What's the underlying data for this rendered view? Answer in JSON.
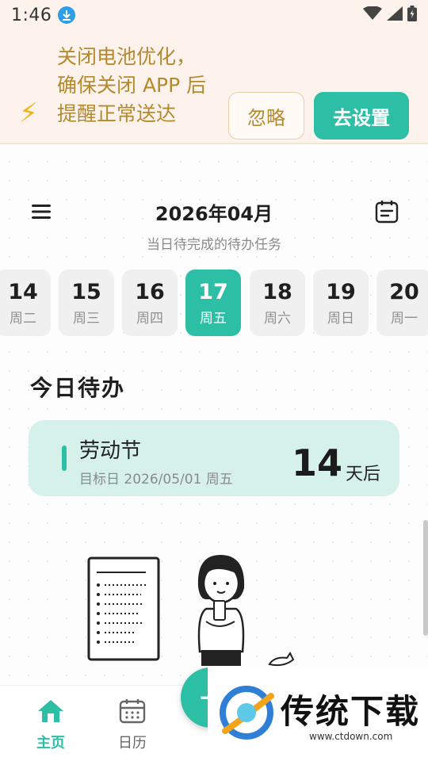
{
  "status_bar": {
    "time": "1:46"
  },
  "banner": {
    "lines": [
      "关闭电池优化，",
      "确保关闭 APP 后",
      "提醒正常送达"
    ],
    "ignore_label": "忽略",
    "settings_label": "去设置"
  },
  "header": {
    "month": "2026年04月",
    "subtitle": "当日待完成的待办任务"
  },
  "days": [
    {
      "num": "14",
      "week": "周二"
    },
    {
      "num": "15",
      "week": "周三"
    },
    {
      "num": "16",
      "week": "周四"
    },
    {
      "num": "17",
      "week": "周五",
      "selected": true
    },
    {
      "num": "18",
      "week": "周六"
    },
    {
      "num": "19",
      "week": "周日"
    },
    {
      "num": "20",
      "week": "周一"
    }
  ],
  "section_title": "今日待办",
  "todo": {
    "name": "劳动节",
    "date": "目标日 2026/05/01 周五",
    "count": "14",
    "unit": "天后"
  },
  "nav": {
    "home_label": "主页",
    "calendar_label": "日历"
  },
  "watermark": {
    "title": "传统下载",
    "url": "www.ctdown.com"
  },
  "colors": {
    "accent": "#2dbfa5",
    "banner_bg": "#fdf3ec",
    "banner_text": "#b58a2e",
    "card_bg": "#d6f1ea"
  }
}
